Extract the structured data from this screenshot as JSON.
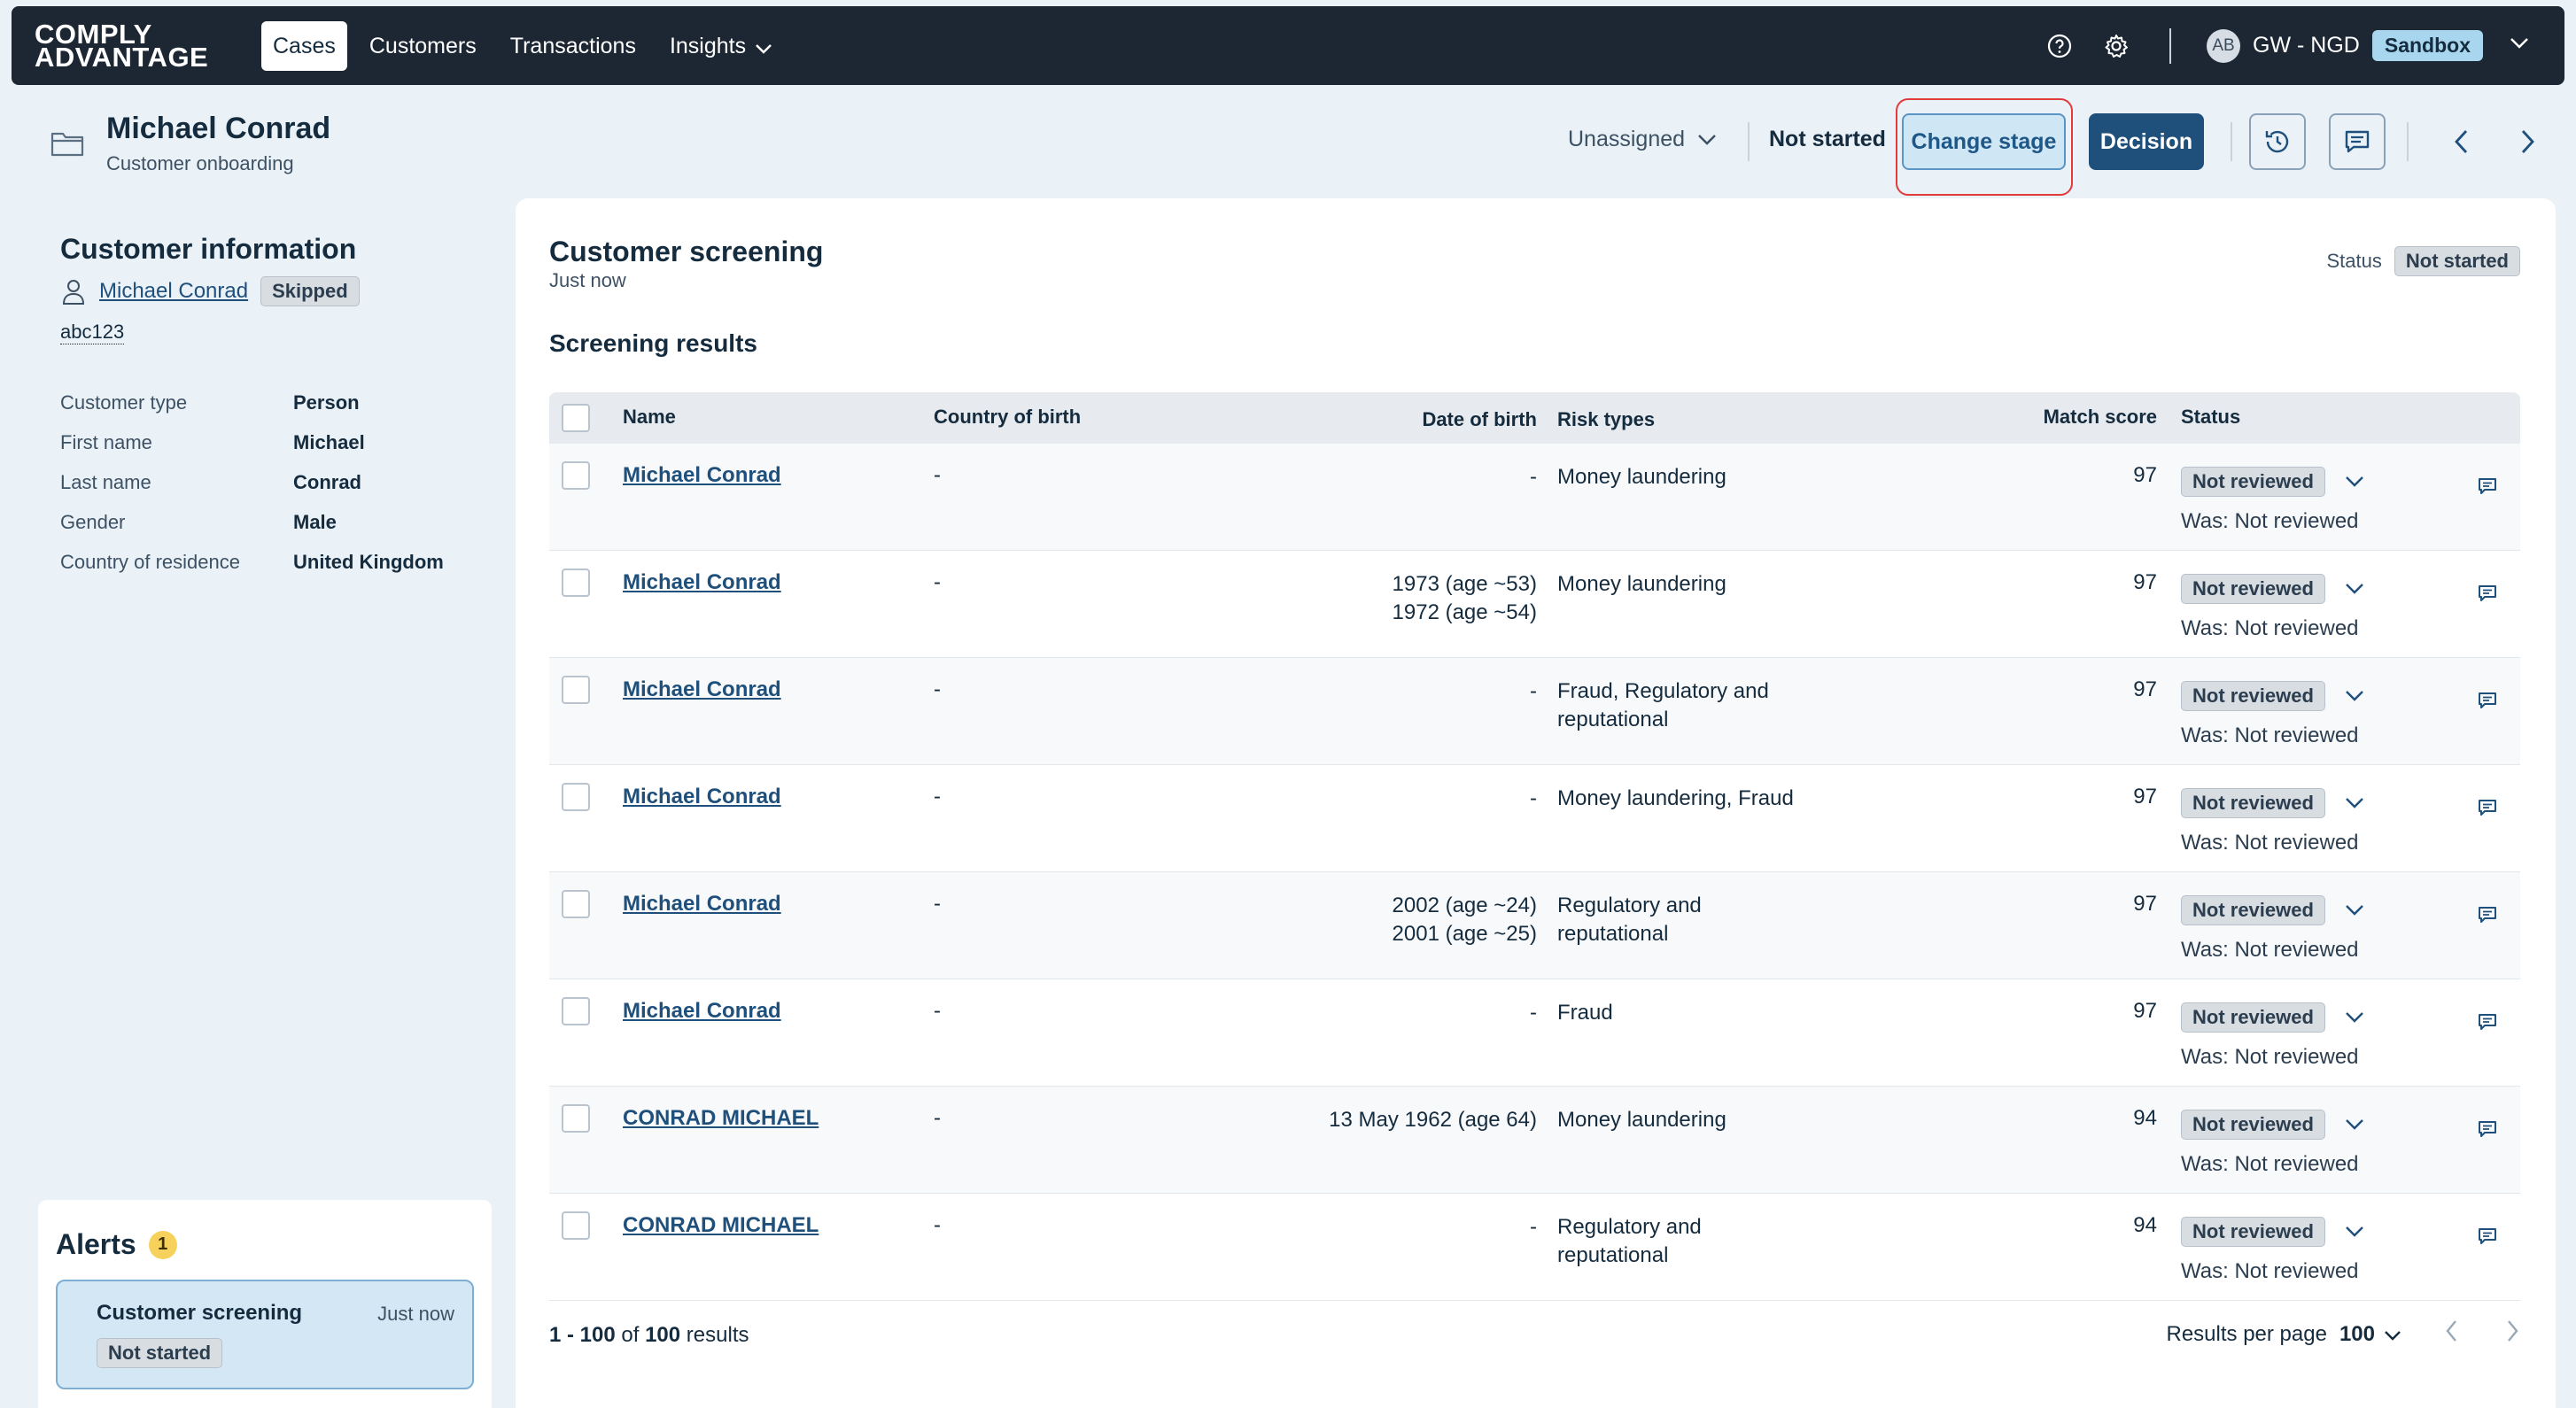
{
  "nav": {
    "logo_line1": "COMPLY",
    "logo_line2": "ADVANTAGE",
    "tabs": [
      {
        "label": "Cases",
        "active": true
      },
      {
        "label": "Customers"
      },
      {
        "label": "Transactions"
      },
      {
        "label": "Insights"
      }
    ],
    "avatar_initials": "AB",
    "org_name": "GW - NGD",
    "env_badge": "Sandbox"
  },
  "case": {
    "title": "Michael Conrad",
    "subtitle": "Customer onboarding",
    "assignee": "Unassigned",
    "stage_status": "Not started",
    "change_stage_label": "Change stage",
    "decision_label": "Decision"
  },
  "customer_info": {
    "heading": "Customer information",
    "name": "Michael Conrad",
    "name_badge": "Skipped",
    "id": "abc123",
    "fields": [
      {
        "label": "Customer type",
        "value": "Person"
      },
      {
        "label": "First name",
        "value": "Michael"
      },
      {
        "label": "Last name",
        "value": "Conrad"
      },
      {
        "label": "Gender",
        "value": "Male"
      },
      {
        "label": "Country of residence",
        "value": "United Kingdom"
      }
    ]
  },
  "alerts": {
    "heading": "Alerts",
    "count": "1",
    "items": [
      {
        "name": "Customer screening",
        "time": "Just now",
        "status": "Not started"
      }
    ]
  },
  "screening": {
    "title": "Customer screening",
    "time": "Just now",
    "status_label": "Status",
    "status_value": "Not started",
    "results_heading": "Screening results",
    "columns": {
      "name": "Name",
      "cob": "Country of birth",
      "dob": "Date of birth",
      "risk": "Risk types",
      "score": "Match score",
      "status": "Status"
    },
    "rows": [
      {
        "name": "Michael Conrad",
        "cob": "-",
        "dob1": "-",
        "dob2": "",
        "risk": "Money laundering",
        "score": "97",
        "status": "Not reviewed",
        "was": "Was: Not reviewed"
      },
      {
        "name": "Michael Conrad",
        "cob": "-",
        "dob1": "1973 (age ~53)",
        "dob2": "1972 (age ~54)",
        "risk": "Money laundering",
        "score": "97",
        "status": "Not reviewed",
        "was": "Was: Not reviewed"
      },
      {
        "name": "Michael Conrad",
        "cob": "-",
        "dob1": "-",
        "dob2": "",
        "risk": "Fraud, Regulatory and reputational",
        "score": "97",
        "status": "Not reviewed",
        "was": "Was: Not reviewed"
      },
      {
        "name": "Michael Conrad",
        "cob": "-",
        "dob1": "-",
        "dob2": "",
        "risk": "Money laundering, Fraud",
        "score": "97",
        "status": "Not reviewed",
        "was": "Was: Not reviewed"
      },
      {
        "name": "Michael Conrad",
        "cob": "-",
        "dob1": "2002 (age ~24)",
        "dob2": "2001 (age ~25)",
        "risk": "Regulatory and reputational",
        "score": "97",
        "status": "Not reviewed",
        "was": "Was: Not reviewed"
      },
      {
        "name": "Michael Conrad",
        "cob": "-",
        "dob1": "-",
        "dob2": "",
        "risk": "Fraud",
        "score": "97",
        "status": "Not reviewed",
        "was": "Was: Not reviewed"
      },
      {
        "name": "CONRAD MICHAEL",
        "cob": "-",
        "dob1": "13 May 1962 (age 64)",
        "dob2": "",
        "risk": "Money laundering",
        "score": "94",
        "status": "Not reviewed",
        "was": "Was: Not reviewed"
      },
      {
        "name": "CONRAD MICHAEL",
        "cob": "-",
        "dob1": "-",
        "dob2": "",
        "risk": "Regulatory and reputational",
        "score": "94",
        "status": "Not reviewed",
        "was": "Was: Not reviewed"
      }
    ],
    "pagination": {
      "range": "1 - 100",
      "of_word": "of",
      "total": "100",
      "results_word": "results",
      "per_page_label": "Results per page",
      "per_page_value": "100"
    }
  },
  "colors": {
    "nav_bg": "#1c2733",
    "primary": "#1f4f7b",
    "highlight_border": "#e23b3b",
    "page_bg": "#eaf1f7"
  }
}
